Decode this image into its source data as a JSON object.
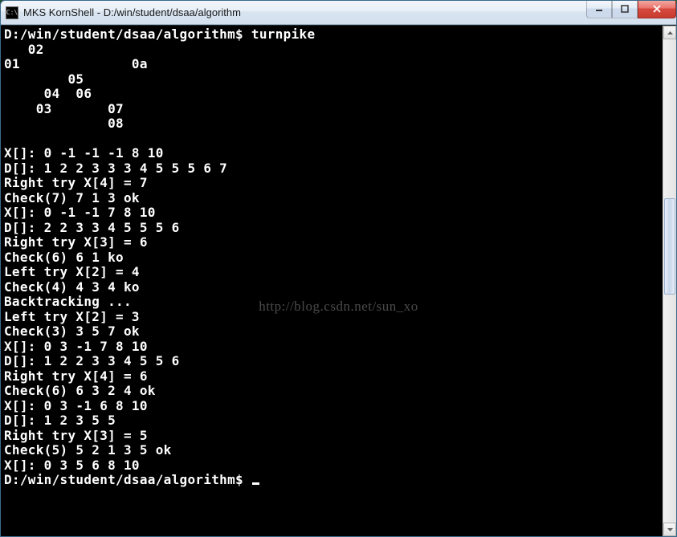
{
  "window": {
    "title": "MKS KornShell - D:/win/student/dsaa/algorithm",
    "icon_label": "C:\\"
  },
  "controls": {
    "minimize": "minimize",
    "maximize": "maximize",
    "close": "close"
  },
  "terminal": {
    "lines": [
      "D:/win/student/dsaa/algorithm$ turnpike",
      "   02",
      "01              0a",
      "        05",
      "     04  06",
      "    03       07",
      "             08",
      "",
      "X[]: 0 -1 -1 -1 8 10",
      "D[]: 1 2 2 3 3 3 4 5 5 5 6 7",
      "Right try X[4] = 7",
      "Check(7) 7 1 3 ok",
      "X[]: 0 -1 -1 7 8 10",
      "D[]: 2 2 3 3 4 5 5 5 6",
      "Right try X[3] = 6",
      "Check(6) 6 1 ko",
      "Left try X[2] = 4",
      "Check(4) 4 3 4 ko",
      "Backtracking ...",
      "Left try X[2] = 3",
      "Check(3) 3 5 7 ok",
      "X[]: 0 3 -1 7 8 10",
      "D[]: 1 2 2 3 3 4 5 5 6",
      "Right try X[4] = 6",
      "Check(6) 6 3 2 4 ok",
      "X[]: 0 3 -1 6 8 10",
      "D[]: 1 2 3 5 5",
      "Right try X[3] = 5",
      "Check(5) 5 2 1 3 5 ok",
      "X[]: 0 3 5 6 8 10"
    ],
    "prompt": "D:/win/student/dsaa/algorithm$ "
  },
  "watermark": "http://blog.csdn.net/sun_xo"
}
